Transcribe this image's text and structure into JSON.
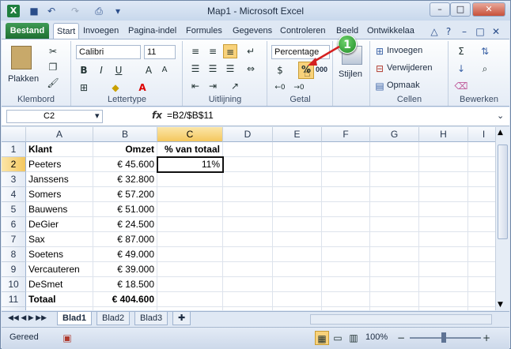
{
  "window": {
    "title": "Map1 - Microsoft Excel"
  },
  "tabs": [
    "Bestand",
    "Start",
    "Invoegen",
    "Pagina-indel",
    "Formules",
    "Gegevens",
    "Controleren",
    "Beeld",
    "Ontwikkelaa"
  ],
  "ribbon": {
    "paste_label": "Plakken",
    "font_name": "Calibri",
    "font_size": "11",
    "number_format": "Percentage",
    "groups": {
      "clipboard": "Klembord",
      "font": "Lettertype",
      "alignment": "Uitlijning",
      "number": "Getal",
      "styles_label": "Stijlen",
      "cells": "Cellen",
      "editing": "Bewerken"
    },
    "cells_items": [
      "Invoegen",
      "Verwijderen",
      "Opmaak"
    ],
    "percent_symbol": "%",
    "thousands_symbol": "000",
    "bold": "B",
    "italic": "I",
    "underline": "U"
  },
  "callout_number": "1",
  "formula_bar": {
    "name_box": "C2",
    "fx": "fx",
    "formula": "=B2/$B$11"
  },
  "columns": [
    "A",
    "B",
    "C",
    "D",
    "E",
    "F",
    "G",
    "H",
    "I"
  ],
  "rows": [
    {
      "n": "1",
      "a": "Klant",
      "b": "Omzet",
      "c": "% van totaal"
    },
    {
      "n": "2",
      "a": "Peeters",
      "b": "€ 45.600",
      "c": "11%"
    },
    {
      "n": "3",
      "a": "Janssens",
      "b": "€ 32.800",
      "c": ""
    },
    {
      "n": "4",
      "a": "Somers",
      "b": "€ 57.200",
      "c": ""
    },
    {
      "n": "5",
      "a": "Bauwens",
      "b": "€ 51.000",
      "c": ""
    },
    {
      "n": "6",
      "a": "DeGier",
      "b": "€ 24.500",
      "c": ""
    },
    {
      "n": "7",
      "a": "Sax",
      "b": "€ 87.000",
      "c": ""
    },
    {
      "n": "8",
      "a": "Soetens",
      "b": "€ 49.000",
      "c": ""
    },
    {
      "n": "9",
      "a": "Vercauteren",
      "b": "€ 39.000",
      "c": ""
    },
    {
      "n": "10",
      "a": "DeSmet",
      "b": "€ 18.500",
      "c": ""
    },
    {
      "n": "11",
      "a": "Totaal",
      "b": "€ 404.600",
      "c": ""
    }
  ],
  "sheets": [
    "Blad1",
    "Blad2",
    "Blad3"
  ],
  "status": {
    "ready": "Gereed",
    "zoom": "100%"
  }
}
